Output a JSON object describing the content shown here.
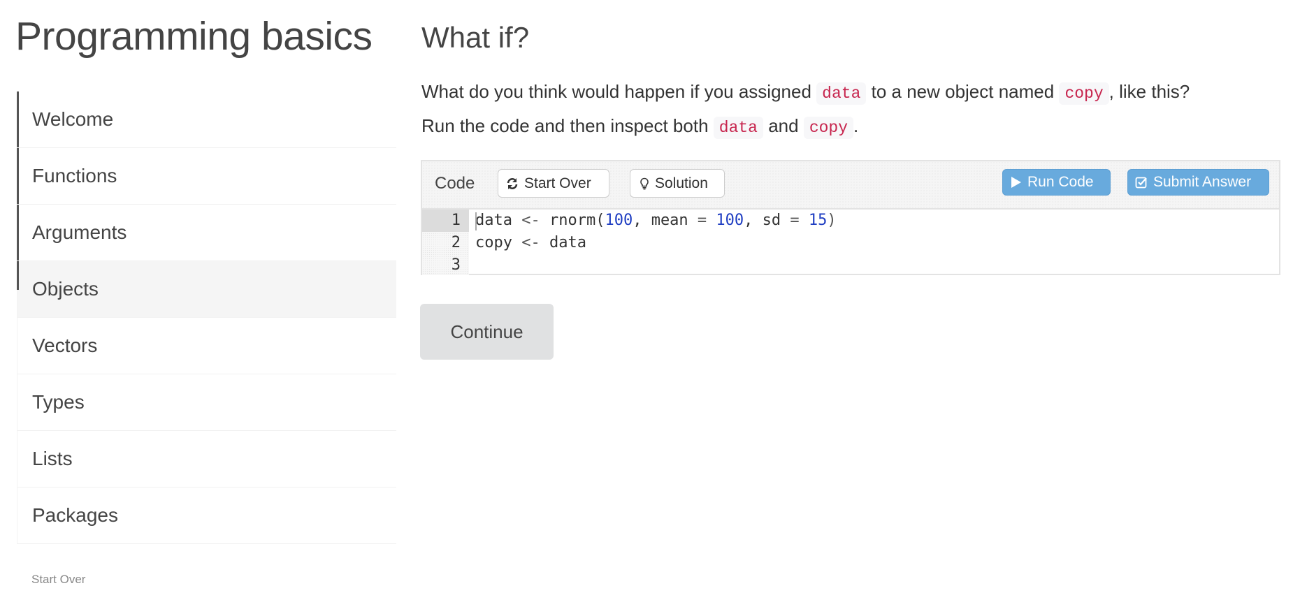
{
  "sidebar": {
    "title": "Programming basics",
    "items": [
      {
        "label": "Welcome",
        "state": "completed"
      },
      {
        "label": "Functions",
        "state": "completed"
      },
      {
        "label": "Arguments",
        "state": "completed"
      },
      {
        "label": "Objects",
        "state": "active"
      },
      {
        "label": "Vectors",
        "state": "pending"
      },
      {
        "label": "Types",
        "state": "pending"
      },
      {
        "label": "Lists",
        "state": "pending"
      },
      {
        "label": "Packages",
        "state": "pending"
      }
    ],
    "footer_link": "Start Over"
  },
  "main": {
    "heading": "What if?",
    "paragraph": {
      "line1_a": "What do you think would happen if you assigned ",
      "code1": "data",
      "line1_b": " to a new object named ",
      "code2": "copy",
      "line1_c": ", like this?",
      "line2_a": "Run the code and then inspect both ",
      "code3": "data",
      "line2_b": " and ",
      "code4": "copy",
      "line2_c": "."
    },
    "editor": {
      "label": "Code",
      "buttons": {
        "start_over": {
          "label": "Start Over",
          "icon": "refresh-icon"
        },
        "solution": {
          "label": "Solution",
          "icon": "lightbulb-icon"
        },
        "run_code": {
          "label": "Run Code",
          "icon": "play-icon"
        },
        "submit": {
          "label": "Submit Answer",
          "icon": "checkbox-icon"
        }
      },
      "line_numbers": [
        "1",
        "2",
        "3"
      ],
      "lines": [
        [
          {
            "t": "data ",
            "c": "id"
          },
          {
            "t": "<-",
            "c": "op"
          },
          {
            "t": " rnorm(",
            "c": "id"
          },
          {
            "t": "100",
            "c": "num"
          },
          {
            "t": ", mean ",
            "c": "id"
          },
          {
            "t": "=",
            "c": "op"
          },
          {
            "t": " ",
            "c": "id"
          },
          {
            "t": "100",
            "c": "num"
          },
          {
            "t": ", sd ",
            "c": "id"
          },
          {
            "t": "=",
            "c": "op"
          },
          {
            "t": " ",
            "c": "id"
          },
          {
            "t": "15",
            "c": "num"
          },
          {
            "t": ")",
            "c": "op"
          }
        ],
        [
          {
            "t": "copy ",
            "c": "id"
          },
          {
            "t": "<-",
            "c": "op"
          },
          {
            "t": " data",
            "c": "id"
          }
        ],
        []
      ]
    },
    "continue_label": "Continue"
  },
  "colors": {
    "primary_button": "#68aadd",
    "inline_code": "#c7254e",
    "number_token": "#1f3ec2",
    "progress_bar": "#555555"
  }
}
